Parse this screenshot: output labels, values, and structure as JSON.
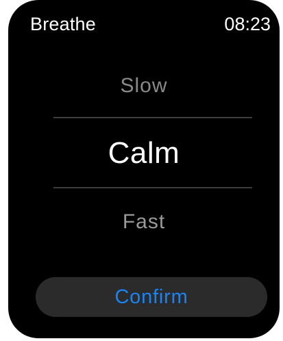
{
  "app": {
    "title": "Breathe",
    "time": "08:23"
  },
  "picker": {
    "options": [
      "Slow",
      "Calm",
      "Fast"
    ],
    "selected": "Calm"
  },
  "actions": {
    "confirm_label": "Confirm"
  },
  "colors": {
    "background": "#000000",
    "text_primary": "#ffffff",
    "text_dimmed": "#8a8a8a",
    "accent": "#1a84f5",
    "button_background": "#2b2b2b",
    "divider": "#3d3d3d"
  }
}
